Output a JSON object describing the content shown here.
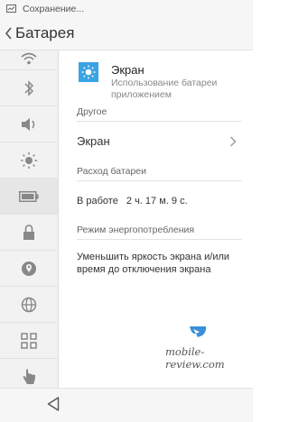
{
  "status_bar": {
    "text": "Сохранение..."
  },
  "header": {
    "title": "Батарея"
  },
  "sidebar": {
    "items": [
      {
        "icon": "wifi-icon"
      },
      {
        "icon": "bluetooth-icon"
      },
      {
        "icon": "sound-icon"
      },
      {
        "icon": "brightness-icon"
      },
      {
        "icon": "battery-icon",
        "active": true
      },
      {
        "icon": "lock-icon"
      },
      {
        "icon": "location-icon"
      },
      {
        "icon": "globe-icon"
      },
      {
        "icon": "apps-grid-icon"
      },
      {
        "icon": "gesture-hand-icon"
      },
      {
        "icon": "info-icon"
      }
    ]
  },
  "main": {
    "app": {
      "name": "Экран",
      "subtitle": "Использование батареи приложением",
      "icon": "sun-icon",
      "icon_color": "#3aa3e3"
    },
    "other_section": {
      "title": "Другое",
      "item_label": "Экран"
    },
    "usage_section": {
      "title": "Расход батареи",
      "label": "В работе",
      "value": "2 ч. 17 м. 9 с."
    },
    "power_section": {
      "title": "Режим энергопотребления",
      "tip": "Уменьшить яркость экрана и/или время до отключения экрана"
    }
  },
  "watermark": {
    "text": "mobile-review.com"
  }
}
